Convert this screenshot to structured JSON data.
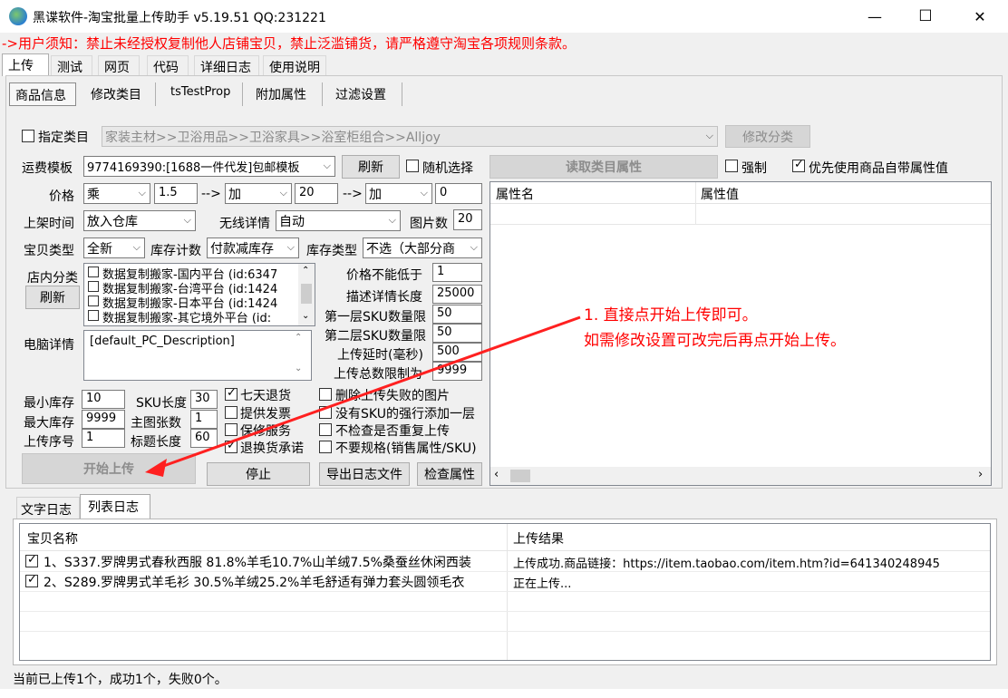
{
  "window": {
    "title": "黑谍软件-淘宝批量上传助手 v5.19.51 QQ:231221",
    "minimize": "—",
    "maximize": "☐",
    "close": "✕"
  },
  "notice": "->用户须知：禁止未经授权复制他人店铺宝贝，禁止泛滥铺货，请严格遵守淘宝各项规则条款。",
  "main_tabs": [
    "上传",
    "测试",
    "网页",
    "代码",
    "详细日志",
    "使用说明"
  ],
  "sub_tabs": [
    "商品信息",
    "修改类目",
    "tsTestProp",
    "附加属性",
    "过滤设置"
  ],
  "category": {
    "checkbox_label": "指定类目",
    "value": "家装主材>>卫浴用品>>卫浴家具>>浴室柜组合>>Alljoy",
    "modify_button": "修改分类"
  },
  "shipping": {
    "label": "运费模板",
    "value": "9774169390:[1688一件代发]包邮模板",
    "refresh_button": "刷新",
    "random_label": "随机选择"
  },
  "price": {
    "label": "价格",
    "op1": "乘",
    "val1": "1.5",
    "arrow1": "-->",
    "op2": "加",
    "val2": "20",
    "arrow2": "-->",
    "op3": "加",
    "val3": "0"
  },
  "listing": {
    "time_label": "上架时间",
    "time_value": "放入仓库",
    "wireless_label": "无线详情",
    "wireless_value": "自动",
    "pics_label": "图片数",
    "pics_value": "20"
  },
  "item_type": {
    "label": "宝贝类型",
    "value": "全新",
    "stock_count_label": "库存计数",
    "stock_count_value": "付款减库存",
    "stock_type_label": "库存类型",
    "stock_type_value": "不选（大部分商"
  },
  "shop_category": {
    "label": "店内分类",
    "refresh_button": "刷新",
    "items": [
      "数据复制搬家-国内平台 (id:6347",
      "数据复制搬家-台湾平台 (id:1424",
      "数据复制搬家-日本平台 (id:1424",
      "数据复制搬家-其它境外平台 (id:"
    ]
  },
  "limits": {
    "min_price_label": "价格不能低于",
    "min_price": "1",
    "desc_len_label": "描述详情长度",
    "desc_len": "25000",
    "sku1_label": "第一层SKU数量限",
    "sku1": "50",
    "sku2_label": "第二层SKU数量限",
    "sku2": "50",
    "delay_label": "上传延时(毫秒)",
    "delay": "500",
    "total_label": "上传总数限制为",
    "total": "9999"
  },
  "pc_detail": {
    "label": "电脑详情",
    "value": "[default_PC_Description]"
  },
  "stock": {
    "min_label": "最小库存",
    "min": "10",
    "max_label": "最大库存",
    "max": "9999",
    "seq_label": "上传序号",
    "seq": "1",
    "sku_len_label": "SKU长度",
    "sku_len": "30",
    "main_pics_label": "主图张数",
    "main_pics": "1",
    "title_len_label": "标题长度",
    "title_len": "60"
  },
  "services": [
    {
      "label": "七天退货",
      "checked": true
    },
    {
      "label": "提供发票",
      "checked": false
    },
    {
      "label": "保修服务",
      "checked": false
    },
    {
      "label": "退换货承诺",
      "checked": true
    }
  ],
  "options": [
    {
      "label": "删除上传失败的图片",
      "checked": false
    },
    {
      "label": "没有SKU的强行添加一层",
      "checked": false
    },
    {
      "label": "不检查是否重复上传",
      "checked": false
    },
    {
      "label": "不要规格(销售属性/SKU)",
      "checked": false
    }
  ],
  "buttons": {
    "start": "开始上传",
    "stop": "停止",
    "export_log": "导出日志文件",
    "check_attr": "检查属性"
  },
  "attributes": {
    "read_button": "读取类目属性",
    "force_label": "强制",
    "prefer_label": "优先使用商品自带属性值",
    "col_name": "属性名",
    "col_value": "属性值"
  },
  "annotation": {
    "line1": "1. 直接点开始上传即可。",
    "line2": "如需修改设置可改完后再点开始上传。"
  },
  "log_tabs": [
    "文字日志",
    "列表日志"
  ],
  "log_table": {
    "col_item": "宝贝名称",
    "col_result": "上传结果",
    "rows": [
      {
        "name": "1、S337.罗牌男式春秋西服 81.8%羊毛10.7%山羊绒7.5%桑蚕丝休闲西装",
        "result": "上传成功.商品链接：https://item.taobao.com/item.htm?id=641340248945"
      },
      {
        "name": "2、S289.罗牌男式羊毛衫 30.5%羊绒25.2%羊毛舒适有弹力套头圆领毛衣",
        "result": "正在上传..."
      }
    ]
  },
  "status": "当前已上传1个，成功1个，失败0个。"
}
